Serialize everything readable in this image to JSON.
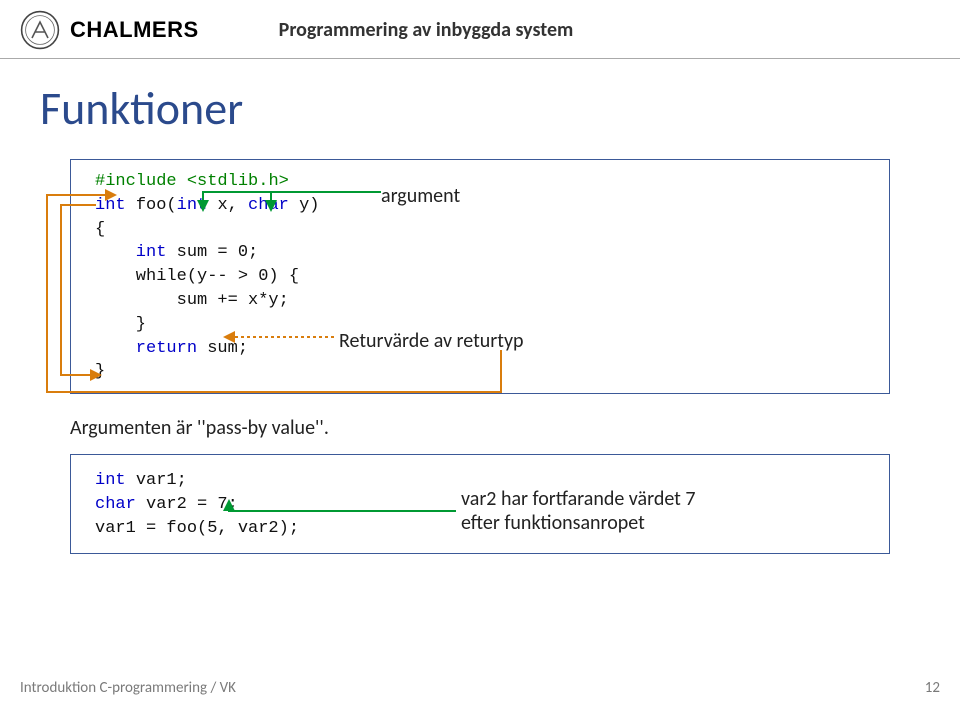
{
  "header": {
    "brand": "CHALMERS",
    "course": "Programmering av inbyggda system"
  },
  "title": "Funktioner",
  "code1": {
    "l1a": "#include ",
    "l1b": "<stdlib.h>",
    "l2a": "int ",
    "l2b": "foo(",
    "l2c": "int ",
    "l2d": "x, ",
    "l2e": "char ",
    "l2f": "y)",
    "l3": "{",
    "l4a": "    int ",
    "l4b": "sum = 0;",
    "l5": "",
    "l6": "    while(y-- > 0) {",
    "l7": "        sum += x*y;",
    "l8": "    }",
    "l9": "",
    "l10a": "    return ",
    "l10b": "sum;",
    "l11": "}"
  },
  "annotations": {
    "argument": "argument",
    "return": "Returvärde av returtyp"
  },
  "body_text": "Argumenten är ''pass-by value''.",
  "code2": {
    "l1a": "int ",
    "l1b": "var1;",
    "l2a": "char ",
    "l2b": "var2 = 7;",
    "l3": "var1 = foo(5, var2);"
  },
  "annotation_var2_line1": "var2  har fortfarande värdet 7",
  "annotation_var2_line2": "efter funktionsanropet",
  "footer": {
    "left": "Introduktion C-programmering / VK",
    "right": "12"
  }
}
